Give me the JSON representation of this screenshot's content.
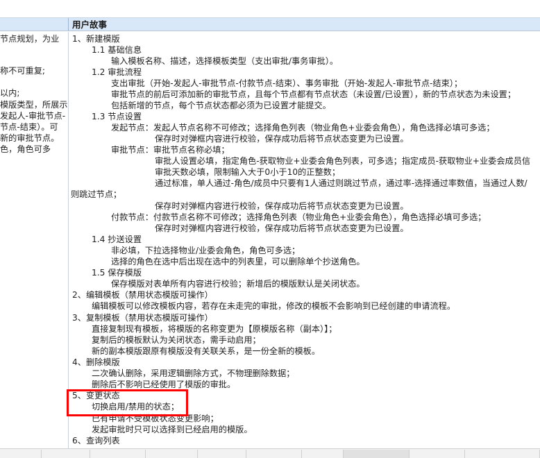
{
  "header": {
    "column_title": "用户故事"
  },
  "left_column": {
    "lines": [
      "节点规划，为业",
      "",
      "称不可重复;",
      "",
      "以内;",
      "模版类型，所展示",
      "发起人-审批节点-",
      "节点-结束）。可",
      "新的审批节点。",
      "色，角色可多"
    ]
  },
  "story": {
    "lines": [
      "1、新建模版",
      "1.1 基础信息",
      "输入模板名称、描述，选择模板类型（支出审批/事务审批）。",
      "1.2 审批流程",
      "支出审批（开始-发起人-审批节点-付款节点-结束）、事务审批（开始-发起人-审批节点-结束）；",
      "审批节点的前后可添加新的审批节点，且每个节点都有节点状态（未设置/已设置），新的节点状态为未设置；",
      "包括新增的节点，每个节点状态都必须为已设置才能提交。",
      "1.3 节点设置",
      "发起节点：发起人节点名称不可修改；选择角色列表（物业角色+业委会角色），角色选择必填可多选；",
      "保存时对弹框内容进行校验，保存成功后将节点状态变更为已设置。",
      "审批节点：审批节点名称必填；",
      "审批人设置必填，指定角色-获取物业+业委会角色列表，可多选；指定成员-获取物业+业委会成员信",
      "审批天数必填，限制输入大于0小于10的正整数；",
      "通过标准，单人通过-角色/成员中只要有1人通过则跳过节点，通过率-选择通过率数值，当通过人数/",
      "则跳过节点；",
      "保存时对弹框内容进行校验，保存成功后将节点状态变更为已设置。",
      "付款节点：付款节点名称不可修改；选择角色列表（物业角色+业委会角色），角色选择必填可多选；",
      "保存时对弹框内容进行校验，保存成功后将节点状态变更为已设置。",
      "1.4 抄送设置",
      "非必填，下拉选择物业/业委会角色，角色可多选；",
      "选择的角色在选中后出现在选中的列表里，可以删除单个抄送角色。",
      "1.5 保存模版",
      "保存模版对表单所有内容进行校验；新增后的模版默认是关闭状态。",
      "2、编辑模板（禁用状态模版可操作）",
      "编辑模板可以修改模板内容，若存在未走完的审批，修改的模板不会影响到已经创建的申请流程。",
      "3、复制模板（禁用状态模版可操作）",
      "直接复制现有模板，将模版的名称变更为【原模版名称（副本）】；",
      "复制后的模板默认为关闭状态，需手动启用；",
      "新的副本模版跟原有模版没有关联关系，是一份全新的模板。",
      "4、删除模版",
      "二次确认删除，采用逻辑删除方式，不物理删除数据；",
      "删除后不影响已经使用了模版的审批。",
      "5、变更状态",
      "切换启用/禁用的状态；",
      "已有申请不受模板状态变更影响；",
      "发起审批时只可以选择到已经启用的模版。",
      "6、查询列表"
    ]
  },
  "colors": {
    "header_bg": "#d9e8f8",
    "highlight": "#ff0000"
  }
}
